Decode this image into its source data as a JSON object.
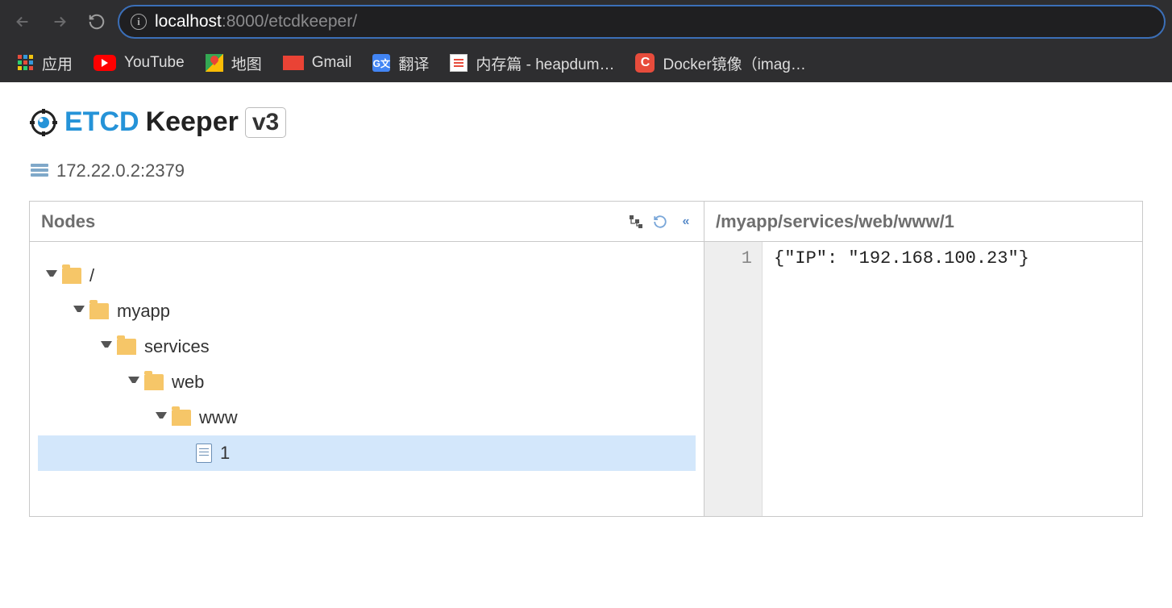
{
  "browser": {
    "url_host": "localhost",
    "url_port": ":8000",
    "url_path": "/etcdkeeper/"
  },
  "bookmarks": {
    "apps": "应用",
    "items": [
      {
        "label": "YouTube"
      },
      {
        "label": "地图"
      },
      {
        "label": "Gmail"
      },
      {
        "label": "翻译"
      },
      {
        "label": "内存篇 - heapdum…"
      },
      {
        "label": "Docker镜像（imag…"
      }
    ]
  },
  "app": {
    "title_etcd": "ETCD",
    "title_keeper": "Keeper",
    "version": "v3",
    "server_address": "172.22.0.2:2379"
  },
  "left_panel": {
    "title": "Nodes",
    "tree": [
      {
        "label": "/",
        "type": "folder",
        "depth": 0
      },
      {
        "label": "myapp",
        "type": "folder",
        "depth": 1
      },
      {
        "label": "services",
        "type": "folder",
        "depth": 2
      },
      {
        "label": "web",
        "type": "folder",
        "depth": 3
      },
      {
        "label": "www",
        "type": "folder",
        "depth": 4
      },
      {
        "label": "1",
        "type": "file",
        "depth": 5,
        "selected": true
      }
    ]
  },
  "right_panel": {
    "title": "/myapp/services/web/www/1",
    "editor": {
      "line_number": "1",
      "content": "{\"IP\": \"192.168.100.23\"}"
    }
  }
}
